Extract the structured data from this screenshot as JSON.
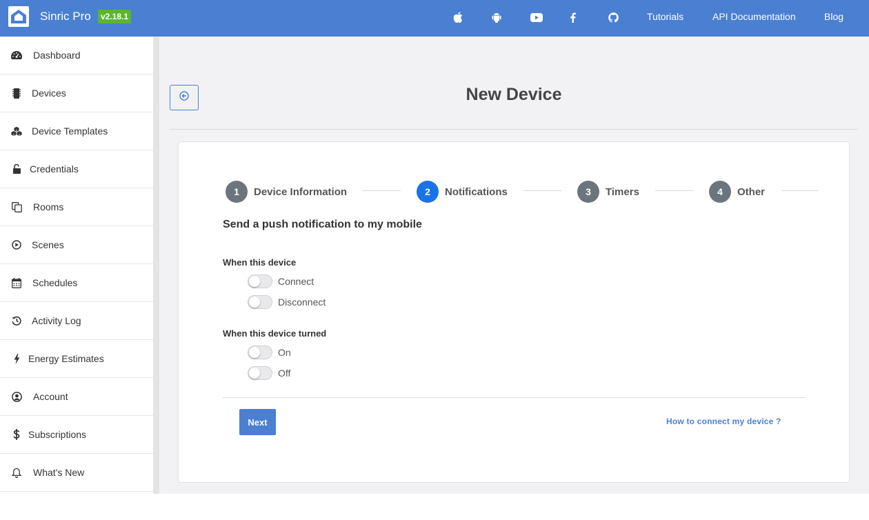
{
  "header": {
    "brand": "Sinric Pro",
    "version": "v2.18.1",
    "icons": [
      "apple-icon",
      "android-icon",
      "youtube-icon",
      "facebook-icon",
      "github-icon"
    ],
    "links": {
      "tutorials": "Tutorials",
      "api_docs": "API Documentation",
      "blog": "Blog"
    },
    "colors": {
      "bar": "#4a7fd2",
      "version_badge": "#5cb531"
    }
  },
  "sidebar": {
    "items": [
      {
        "label": "Dashboard",
        "icon": "dashboard-icon"
      },
      {
        "label": "Devices",
        "icon": "microchip-icon"
      },
      {
        "label": "Device Templates",
        "icon": "cubes-icon"
      },
      {
        "label": "Credentials",
        "icon": "unlock-icon"
      },
      {
        "label": "Rooms",
        "icon": "copy-icon"
      },
      {
        "label": "Scenes",
        "icon": "play-circle-icon"
      },
      {
        "label": "Schedules",
        "icon": "calendar-icon"
      },
      {
        "label": "Activity Log",
        "icon": "history-icon"
      },
      {
        "label": "Energy Estimates",
        "icon": "bolt-icon"
      },
      {
        "label": "Account",
        "icon": "user-circle-icon"
      },
      {
        "label": "Subscriptions",
        "icon": "dollar-icon"
      },
      {
        "label": "What's New",
        "icon": "bell-icon"
      }
    ]
  },
  "page": {
    "title": "New Device",
    "back_icon": "arrow-circle-left-icon"
  },
  "wizard": {
    "steps": [
      {
        "number": "1",
        "label": "Device Information",
        "active": false
      },
      {
        "number": "2",
        "label": "Notifications",
        "active": true
      },
      {
        "number": "3",
        "label": "Timers",
        "active": false
      },
      {
        "number": "4",
        "label": "Other",
        "active": false
      }
    ],
    "colors": {
      "active": "#1a73e8",
      "inactive": "#6c757d"
    }
  },
  "form": {
    "section_title": "Send a push notification to my mobile",
    "group1": {
      "label": "When this device",
      "toggles": [
        {
          "label": "Connect",
          "checked": false
        },
        {
          "label": "Disconnect",
          "checked": false
        }
      ]
    },
    "group2": {
      "label": "When this device turned",
      "toggles": [
        {
          "label": "On",
          "checked": false
        },
        {
          "label": "Off",
          "checked": false
        }
      ]
    },
    "next_label": "Next",
    "help_link": "How to connect my device ?"
  }
}
